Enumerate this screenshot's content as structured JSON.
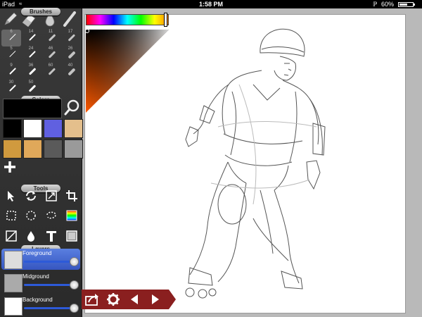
{
  "status_bar": {
    "carrier": "iPad",
    "time": "1:58 PM",
    "battery_text": "60%",
    "battery_level": 0.6
  },
  "panels": {
    "brushes": "Brushes",
    "colors": "Colors",
    "tools": "Tools",
    "layers": "Layers"
  },
  "brush_sizes": {
    "row1": [
      "6",
      "14",
      "11",
      "17"
    ],
    "row2": [
      "5",
      "24",
      "46",
      "26"
    ],
    "row3": [
      "9",
      "36",
      "60",
      "40"
    ],
    "row4": [
      "30",
      "50",
      "",
      ""
    ]
  },
  "swatches": [
    {
      "color": "#000000"
    },
    {
      "color": "#ffffff"
    },
    {
      "color": "#6060e0"
    },
    {
      "color": "#e4bf8c"
    },
    {
      "color": "#d09a3e"
    },
    {
      "color": "#e0a85a"
    },
    {
      "color": "#5a5a5a"
    },
    {
      "color": "#9a9a9a"
    }
  ],
  "current_color": "#000000",
  "hue_position": 0.97,
  "layers": [
    {
      "name": "Foreground",
      "opacity": 1.0,
      "active": true
    },
    {
      "name": "Midground",
      "opacity": 1.0,
      "active": false
    },
    {
      "name": "Background",
      "opacity": 1.0,
      "active": false
    }
  ],
  "accent": "#8a1f1f"
}
